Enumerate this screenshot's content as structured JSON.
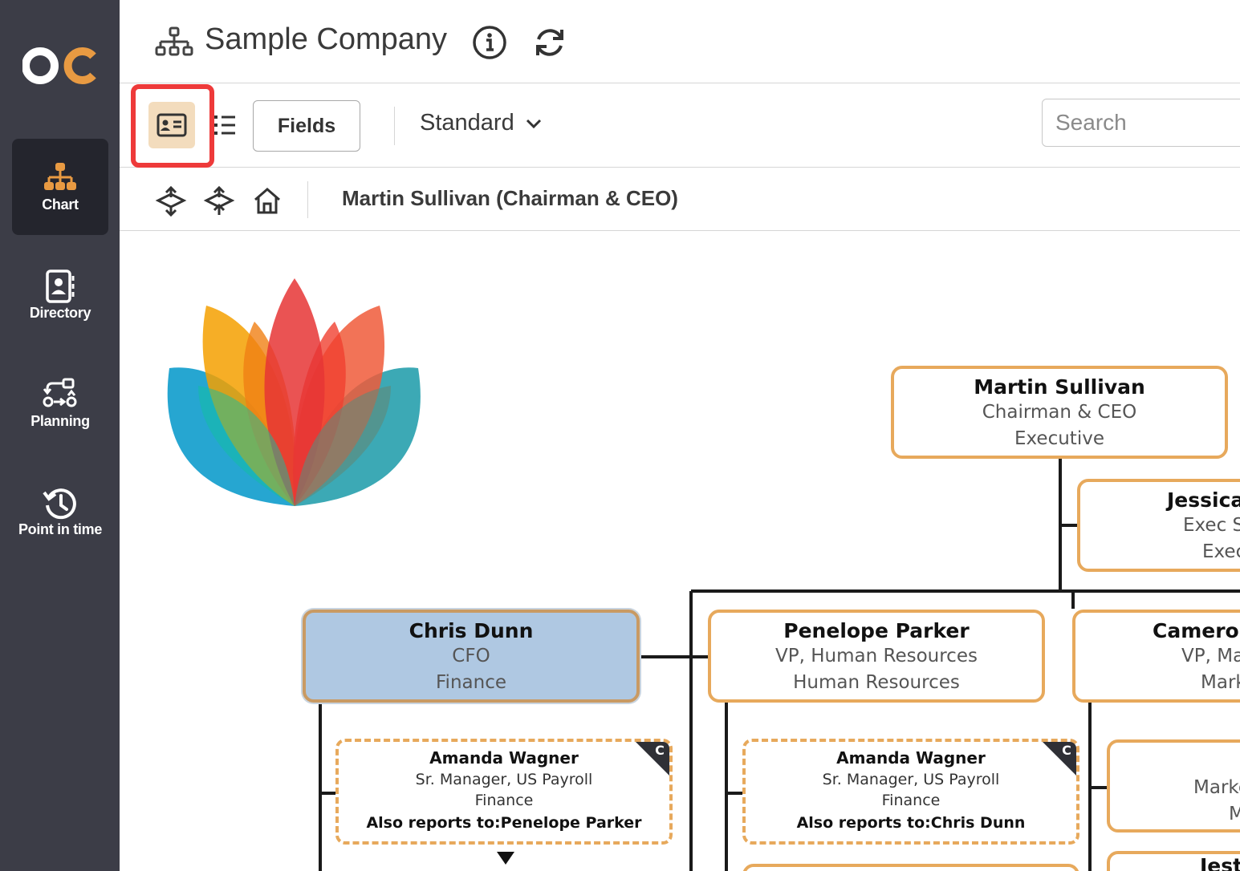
{
  "sidebar": {
    "logo_text": "OC",
    "items": [
      {
        "label": "Chart",
        "icon": "org-chart-icon",
        "active": true
      },
      {
        "label": "Directory",
        "icon": "contact-book-icon",
        "active": false
      },
      {
        "label": "Planning",
        "icon": "planning-flow-icon",
        "active": false
      },
      {
        "label": "Point in time",
        "icon": "history-clock-icon",
        "active": false
      }
    ]
  },
  "header": {
    "title": "Sample Company"
  },
  "toolbar": {
    "fields_label": "Fields",
    "layout_value": "Standard",
    "search_placeholder": "Search"
  },
  "breadcrumb": {
    "text": "Martin Sullivan (Chairman & CEO)"
  },
  "colors": {
    "sidebar_bg": "#3c3d47",
    "accent_orange": "#e7a95c",
    "selected_node": "#afc8e2",
    "highlight_red": "#ee3a3a"
  },
  "chart": {
    "root": {
      "name": "Martin Sullivan",
      "title": "Chairman & CEO",
      "dept": "Executive"
    },
    "assistant_partial": {
      "name": "Jessica",
      "title": "Exec Se",
      "dept": "Exec"
    },
    "children": [
      {
        "name": "Chris  Dunn",
        "title": "CFO",
        "dept": "Finance",
        "selected": true
      },
      {
        "name": "Penelope Parker",
        "title": "VP, Human Resources",
        "dept": "Human Resources",
        "selected": false
      },
      {
        "name": "Cameron",
        "title": "VP, Mar",
        "dept": "Mark",
        "selected": false
      }
    ],
    "sub_assistants": [
      {
        "name": "Amanda Wagner",
        "title": "Sr. Manager, US Payroll",
        "dept": "Finance",
        "also_label": "Also reports to:",
        "also_name": "Penelope Parker",
        "badge": "C"
      },
      {
        "name": "Amanda Wagner",
        "title": "Sr. Manager, US Payroll",
        "dept": "Finance",
        "also_label": "Also reports to:",
        "also_name": "Chris  Dunn",
        "badge": "C"
      }
    ],
    "partial_right": {
      "line1": "Marke",
      "line2": "M"
    },
    "partial_bottom": "Jest"
  }
}
